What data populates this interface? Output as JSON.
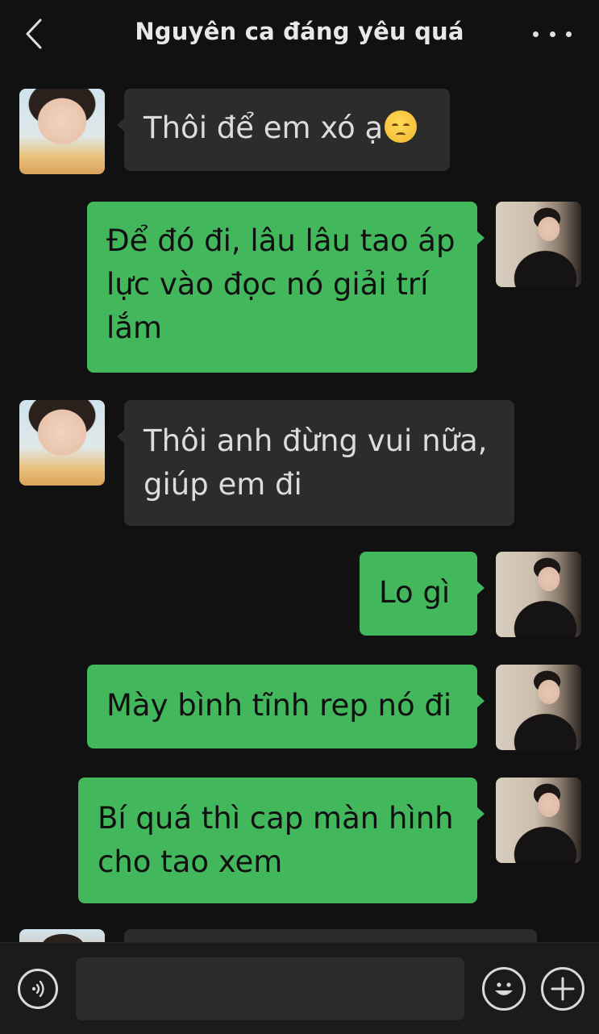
{
  "header": {
    "title": "Nguyên ca đáng yêu quá"
  },
  "messages": [
    {
      "side": "them",
      "text": "Thôi để em xó ạ",
      "emoji": "pensive-face-emoji"
    },
    {
      "side": "me",
      "text": "Để đó đi, lâu lâu tao áp\nlực vào đọc nó giải trí\nlắm"
    },
    {
      "side": "them",
      "text": "Thôi anh đừng vui nữa,\ngiúp em đi"
    },
    {
      "side": "me",
      "text": "Lo gì"
    },
    {
      "side": "me",
      "text": "Mày bình tĩnh rep nó đi"
    },
    {
      "side": "me",
      "text": "Bí quá thì cap màn hình\ncho tao xem"
    }
  ],
  "colors": {
    "background": "#111111",
    "my_bubble": "#43b75c",
    "their_bubble": "#2c2c2c"
  },
  "icons": {
    "back": "chevron-left-icon",
    "more": "more-dots-icon",
    "voice": "voice-icon",
    "emoji": "smiley-icon",
    "add": "plus-icon"
  }
}
